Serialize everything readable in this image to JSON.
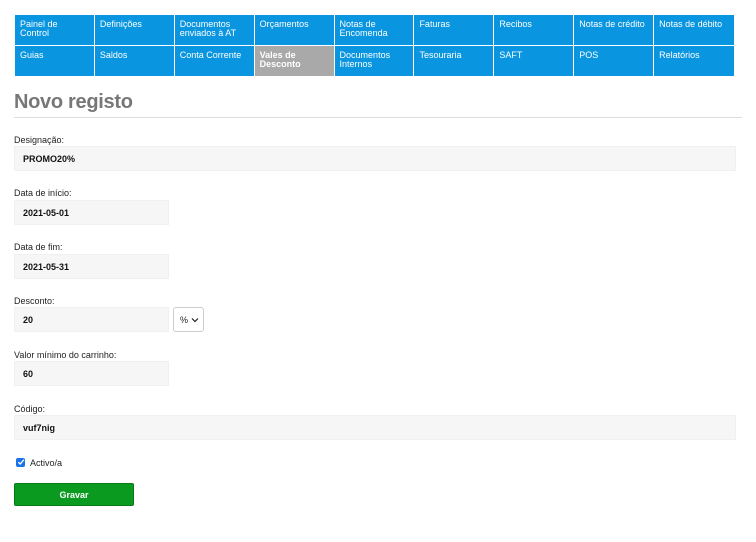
{
  "nav": {
    "row1": [
      {
        "label": "Painel de Control"
      },
      {
        "label": "Definições"
      },
      {
        "label": "Documentos enviados à AT"
      },
      {
        "label": "Orçamentos"
      },
      {
        "label": "Notas de Encomenda"
      },
      {
        "label": "Faturas"
      },
      {
        "label": "Recibos"
      },
      {
        "label": "Notas de crédito"
      },
      {
        "label": "Notas de débito"
      }
    ],
    "row2": [
      {
        "label": "Guias"
      },
      {
        "label": "Saldos"
      },
      {
        "label": "Conta Corrente"
      },
      {
        "label": "Vales de Desconto",
        "active": true
      },
      {
        "label": "Documentos Internos"
      },
      {
        "label": "Tesouraria"
      },
      {
        "label": "SAFT"
      },
      {
        "label": "POS"
      },
      {
        "label": "Relatórios"
      }
    ]
  },
  "page": {
    "title": "Novo registo"
  },
  "form": {
    "designacao": {
      "label": "Designação:",
      "value": "PROMO20%"
    },
    "data_inicio": {
      "label": "Data de início:",
      "value": "2021-05-01"
    },
    "data_fim": {
      "label": "Data de fim:",
      "value": "2021-05-31"
    },
    "desconto": {
      "label": "Desconto:",
      "value": "20",
      "unit": "%"
    },
    "valor_minimo": {
      "label": "Valor mínimo do carrinho:",
      "value": "60"
    },
    "codigo": {
      "label": "Código:",
      "value": "vuf7nig"
    },
    "activo": {
      "label": "Activo/a",
      "checked": true
    },
    "save_label": "Gravar"
  },
  "colors": {
    "nav": "#0a95e0",
    "nav_active": "#a9a9a9",
    "save": "#0a9a20",
    "checkbox": "#1a73e8"
  }
}
